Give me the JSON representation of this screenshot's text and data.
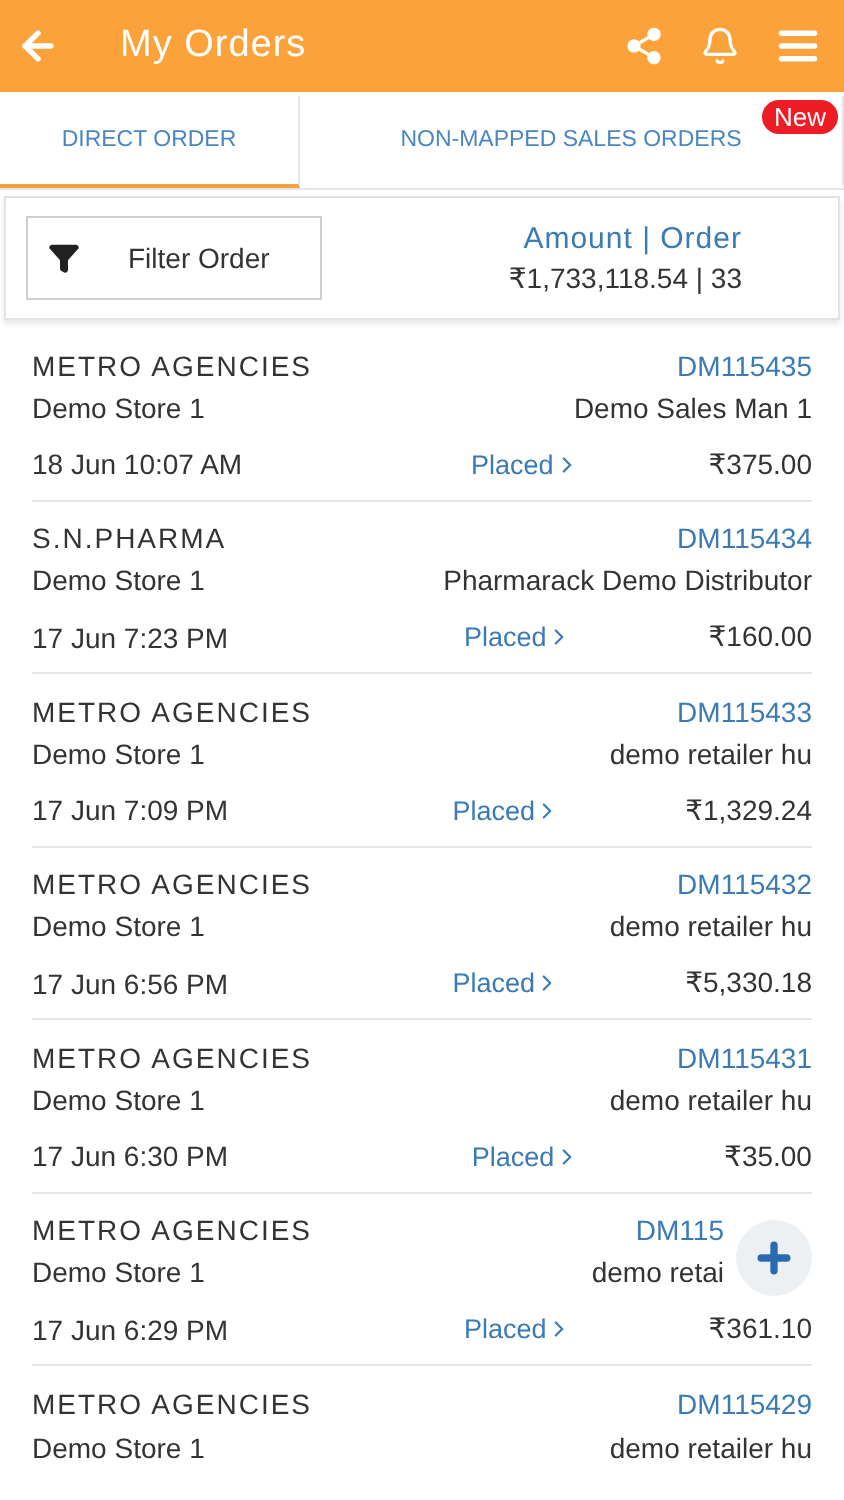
{
  "header": {
    "title": "My Orders"
  },
  "tabs": [
    {
      "label": "DIRECT ORDER",
      "selected": true
    },
    {
      "label": "NON-MAPPED SALES ORDERS",
      "selected": false,
      "badge": "New"
    }
  ],
  "filter": {
    "label": "Filter Order"
  },
  "summary": {
    "heading": "Amount | Order",
    "value": "₹1,733,118.54 | 33"
  },
  "orders": [
    {
      "customer": "METRO AGENCIES",
      "id": "DM115435",
      "store": "Demo Store 1",
      "party": "Demo Sales Man 1",
      "time": "18 Jun 10:07 AM",
      "status": "Placed",
      "amount": "₹375.00"
    },
    {
      "customer": "S.N.PHARMA",
      "id": "DM115434",
      "store": "Demo Store 1",
      "party": "Pharmarack Demo Distributor",
      "time": "17 Jun 7:23 PM",
      "status": "Placed",
      "amount": "₹160.00"
    },
    {
      "customer": "METRO AGENCIES",
      "id": "DM115433",
      "store": "Demo Store 1",
      "party": "demo retailer hu",
      "time": "17 Jun 7:09 PM",
      "status": "Placed",
      "amount": "₹1,329.24"
    },
    {
      "customer": "METRO AGENCIES",
      "id": "DM115432",
      "store": "Demo Store 1",
      "party": "demo retailer hu",
      "time": "17 Jun 6:56 PM",
      "status": "Placed",
      "amount": "₹5,330.18"
    },
    {
      "customer": "METRO AGENCIES",
      "id": "DM115431",
      "store": "Demo Store 1",
      "party": "demo retailer hu",
      "time": "17 Jun 6:30 PM",
      "status": "Placed",
      "amount": "₹35.00"
    },
    {
      "customer": "METRO AGENCIES",
      "id": "DM115",
      "store": "Demo Store 1",
      "party": "demo retai",
      "covered": true,
      "time": "17 Jun 6:29 PM",
      "status": "Placed",
      "amount": "₹361.10"
    },
    {
      "customer": "METRO AGENCIES",
      "id": "DM115429",
      "store": "Demo Store 1",
      "party": "demo retailer hu"
    }
  ]
}
